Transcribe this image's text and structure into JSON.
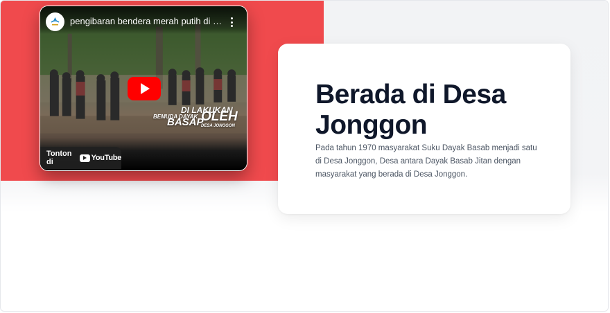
{
  "video": {
    "title": "pengibaran bendera merah putih di wi...",
    "overlay_lines": [
      "DI LAKUKAN",
      "BEMUDA DAYAK",
      "OLEH",
      "BASAP",
      "DESA JONGGON"
    ],
    "watch_label": "Tonton di",
    "youtube_wordmark": "YouTube",
    "play_icon": "play-icon",
    "menu_icon": "more-vertical-icon"
  },
  "content": {
    "heading": "Berada di Desa Jonggon",
    "body": "Pada tahun 1970 masyarakat Suku Dayak Basab menjadi satu di Desa Jonggon, Desa antara Dayak Basab Jitan dengan masyarakat yang berada di Desa Jonggon."
  },
  "colors": {
    "accent_red": "#f04a4d",
    "youtube_red": "#ff0000",
    "heading": "#0f172a",
    "body_text": "#4b5563",
    "panel_gray": "#f3f4f6"
  }
}
